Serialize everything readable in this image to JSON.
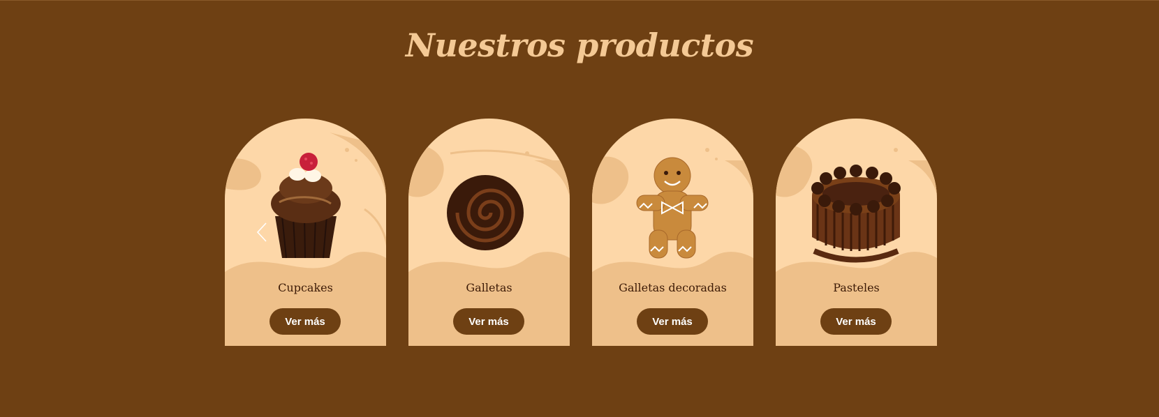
{
  "section": {
    "title": "Nuestros productos"
  },
  "carousel": {
    "prev_icon": "chevron-left-icon",
    "products": [
      {
        "label": "Cupcakes",
        "button_label": "Ver más",
        "image": "cupcake"
      },
      {
        "label": "Galletas",
        "button_label": "Ver más",
        "image": "chocolate-cookie"
      },
      {
        "label": "Galletas decoradas",
        "button_label": "Ver más",
        "image": "gingerbread-man"
      },
      {
        "label": "Pasteles",
        "button_label": "Ver más",
        "image": "chocolate-cake"
      }
    ]
  },
  "colors": {
    "background": "#6e4013",
    "title": "#f4c995",
    "card": "#fdd7a8",
    "card_wave": "#eec08a",
    "button": "#6e4013",
    "label": "#3c1a06"
  }
}
